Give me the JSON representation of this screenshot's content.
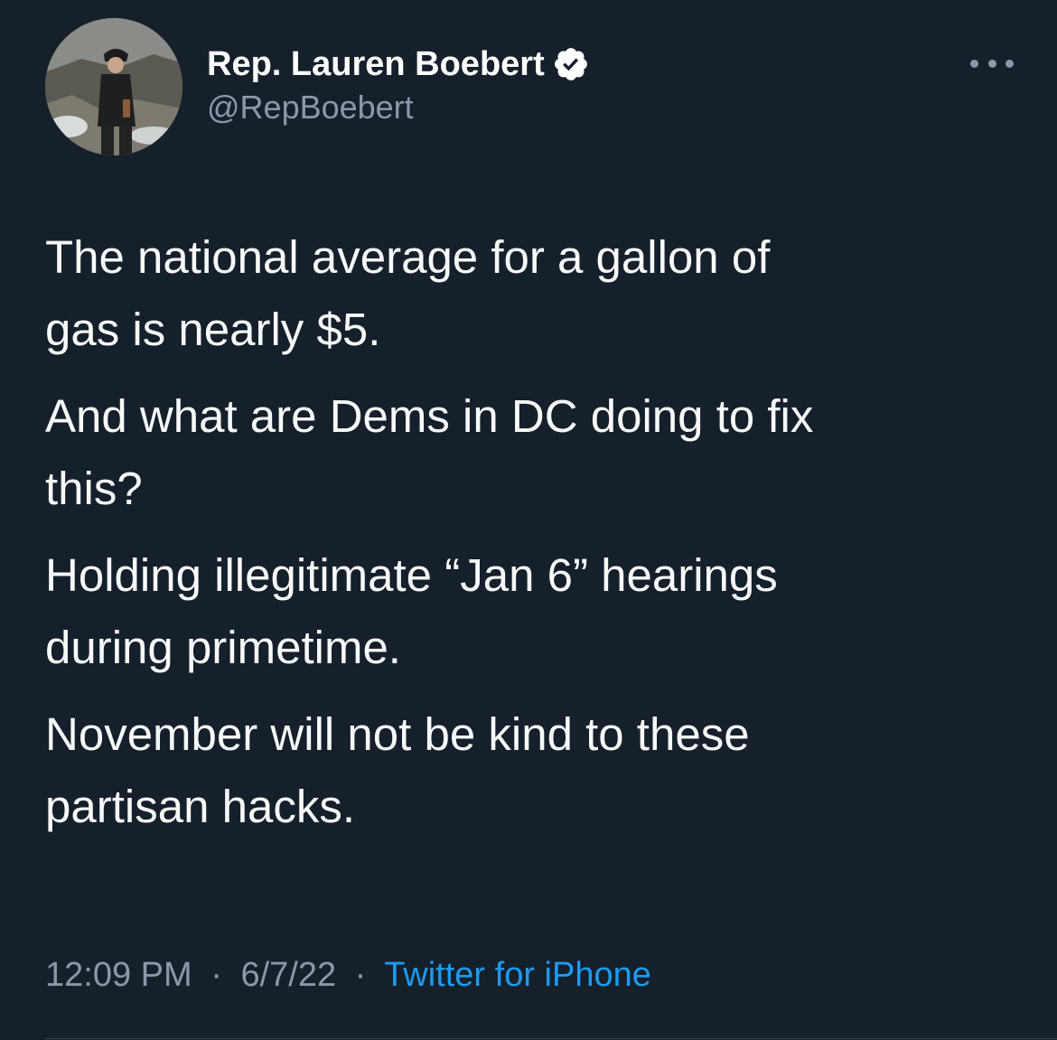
{
  "colors": {
    "background": "#15202b",
    "text": "#f7f9f9",
    "muted": "#8b98a5",
    "link": "#1d9bf0",
    "verified_badge": "#ffffff"
  },
  "author": {
    "display_name": "Rep. Lauren Boebert",
    "handle": "@RepBoebert",
    "verified": true,
    "avatar_icon": "profile-photo"
  },
  "more_menu_icon": "more-horizontal-icon",
  "tweet": {
    "paragraphs": [
      "The national average for a gallon of\ngas is nearly $5.",
      "And what are Dems in DC doing to fix\nthis?",
      "Holding illegitimate “Jan 6” hearings\nduring primetime.",
      "November will not be kind to these\npartisan hacks."
    ],
    "time": "12:09 PM",
    "date": "6/7/22",
    "separator": "·",
    "source": "Twitter for iPhone"
  }
}
